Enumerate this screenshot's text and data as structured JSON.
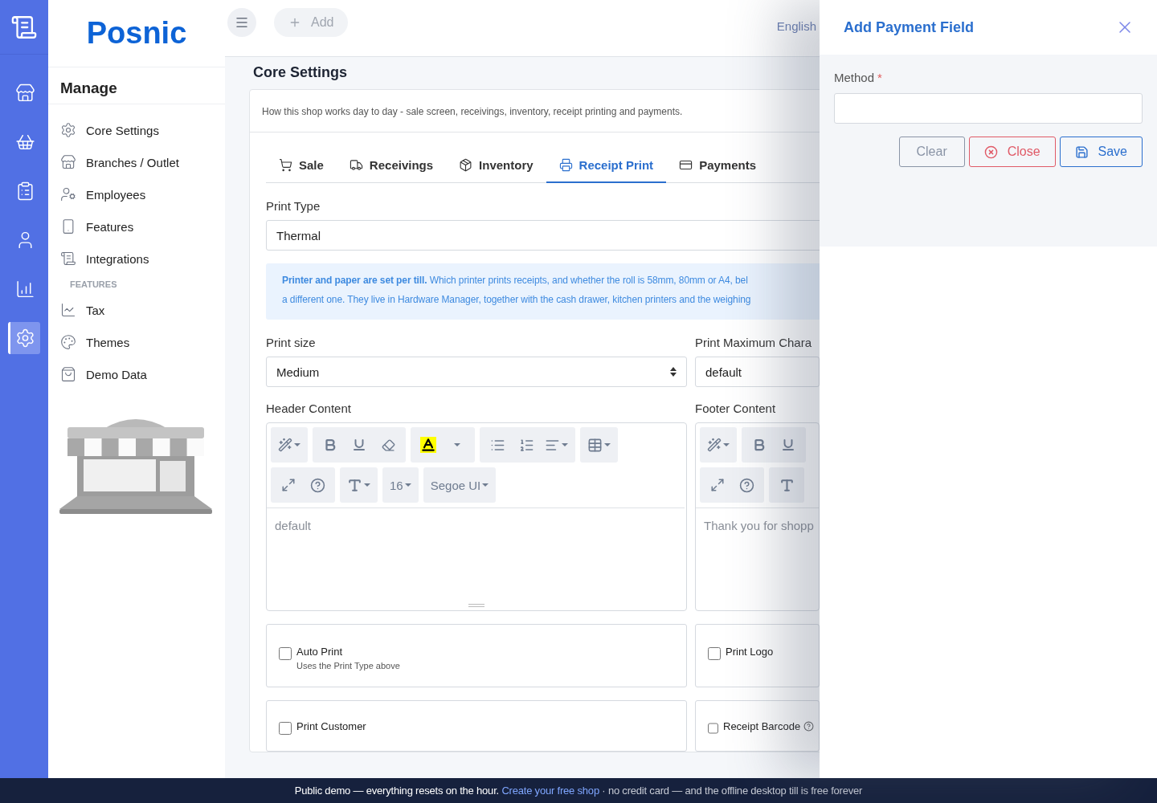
{
  "rail": {
    "items": [
      {
        "kind": "store",
        "selected": false
      },
      {
        "kind": "basket",
        "selected": false
      },
      {
        "kind": "clipboard",
        "selected": false
      },
      {
        "kind": "user",
        "selected": false
      },
      {
        "kind": "chart",
        "selected": false
      },
      {
        "kind": "settings",
        "selected": true
      }
    ]
  },
  "brand": "Posnic",
  "manage": {
    "title": "Manage",
    "items": [
      {
        "label": "Core Settings",
        "kind": "settings",
        "selected": false
      },
      {
        "label": "Branches / Outlet",
        "kind": "store",
        "selected": false
      },
      {
        "label": "Employees",
        "kind": "employees",
        "selected": false
      },
      {
        "label": "Features",
        "kind": "device",
        "selected": false
      },
      {
        "label": "Integrations",
        "kind": "receipt",
        "selected": false
      }
    ],
    "section": "FEATURES",
    "features": [
      {
        "label": "Tax",
        "kind": "chart",
        "selected": false
      },
      {
        "label": "Themes",
        "kind": "palette",
        "selected": false
      },
      {
        "label": "Demo Data",
        "kind": "bag",
        "selected": false
      }
    ]
  },
  "topbar": {
    "add_label": "Add",
    "language": "English"
  },
  "page_title": "Core Settings",
  "card": {
    "description": "How this shop works day to day - sale screen, receivings, inventory, receipt printing and payments.",
    "tabs": [
      {
        "label": "Sale",
        "kind": "cart",
        "selected": false
      },
      {
        "label": "Receivings",
        "kind": "truck",
        "selected": false
      },
      {
        "label": "Inventory",
        "kind": "box",
        "selected": false
      },
      {
        "label": "Receipt Print",
        "kind": "printer",
        "selected": true
      },
      {
        "label": "Payments",
        "kind": "card",
        "selected": false
      }
    ],
    "print_type": {
      "label": "Print Type",
      "value": "Thermal"
    },
    "info_lines": [
      "**Printer and paper are set per till.** Which printer prints receipts, and whether the roll is 58mm, 80mm or A4, bel",
      "a different one. They live in Hardware Manager, together with the cash drawer, kitchen printers and the weighing"
    ],
    "print_size": {
      "label": "Print size",
      "value": "Medium"
    },
    "max_chars": {
      "label": "Print Maximum Chara",
      "value": "default"
    },
    "header": {
      "label": "Header Content",
      "font_size": "16",
      "font_family": "Segoe UI",
      "content": "default"
    },
    "footer": {
      "label": "Footer Content",
      "content": "Thank you for shopp"
    },
    "options": [
      {
        "label": "Auto Print",
        "description": "Uses the Print Type above",
        "checked": false,
        "help": false
      },
      {
        "label": "Print Logo",
        "checked": false,
        "help": false
      },
      {
        "label": "Print Customer",
        "checked": false,
        "help": false
      },
      {
        "label": "Receipt Barcode",
        "checked": false,
        "help": true
      }
    ]
  },
  "drawer": {
    "title": "Add Payment Field",
    "field_label": "Method",
    "required_mark": "*",
    "buttons": [
      {
        "label": "Clear",
        "kind": "clear"
      },
      {
        "label": "Close",
        "kind": "close"
      },
      {
        "label": "Save",
        "kind": "save"
      }
    ]
  },
  "banner": {
    "lead": "Public demo — everything resets on the hour.",
    "link": "Create your free shop",
    "rest": "· no credit card — and the offline desktop till is free forever"
  }
}
